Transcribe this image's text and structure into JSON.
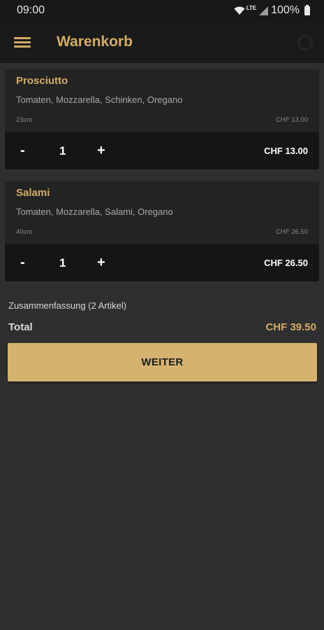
{
  "status_bar": {
    "time": "09:00",
    "network": "LTE",
    "battery": "100%"
  },
  "app_bar": {
    "title": "Warenkorb",
    "menu_icon": "hamburger-menu-icon",
    "action_icon": "refresh-icon"
  },
  "cart": {
    "items": [
      {
        "name": "Prosciutto",
        "ingredients": "Tomaten, Mozzarella, Schinken, Oregano",
        "size": "23cm",
        "unit_price": "CHF 13.00",
        "minus_label": "-",
        "quantity": "1",
        "plus_label": "+",
        "total": "CHF 13.00"
      },
      {
        "name": "Salami",
        "ingredients": "Tomaten, Mozzarella, Salami, Oregano",
        "size": "40cm",
        "unit_price": "CHF 26.50",
        "minus_label": "-",
        "quantity": "1",
        "plus_label": "+",
        "total": "CHF 26.50"
      }
    ]
  },
  "summary": {
    "label": "Zusammenfassung (2 Artikel)",
    "total_label": "Total",
    "total_value": "CHF 39.50"
  },
  "actions": {
    "continue_label": "WEITER"
  },
  "colors": {
    "accent": "#d3ac67",
    "background": "#2f2f2f",
    "card": "#232323",
    "card_controls": "#151515",
    "button": "#d5b26f"
  }
}
